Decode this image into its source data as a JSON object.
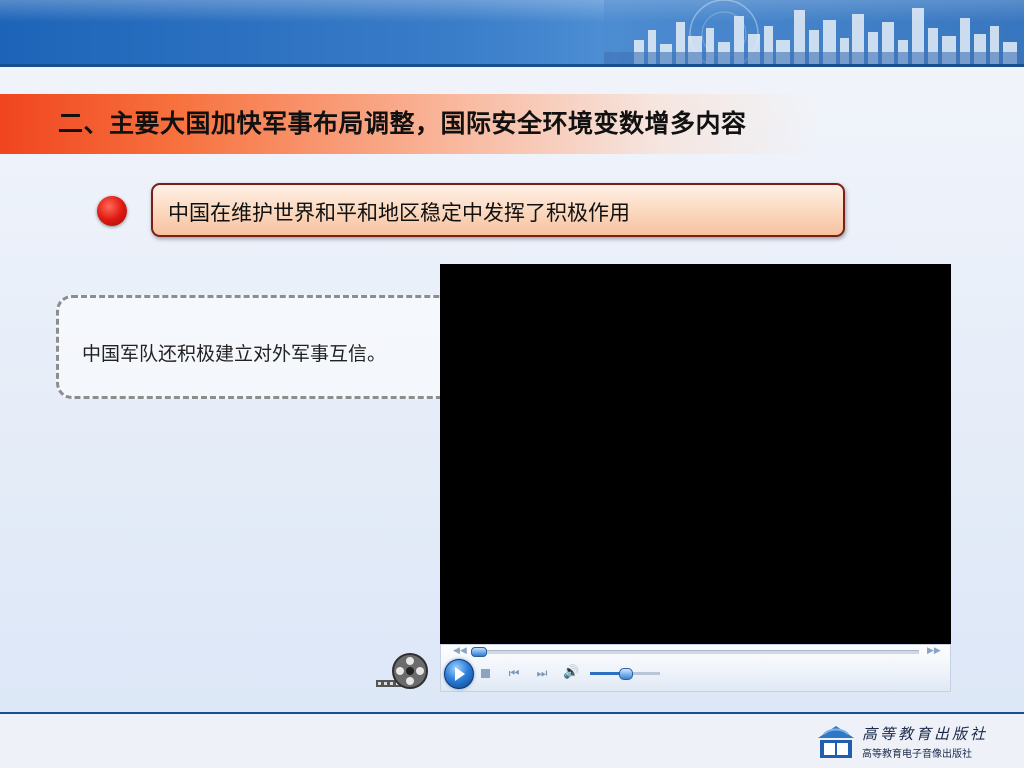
{
  "slide": {
    "section_title": "二、主要大国加快军事布局调整，国际安全环境变数增多内容",
    "key_point": "中国在维护世界和平和地区稳定中发挥了积极作用",
    "detail_text": "中国军队还积极建立对外军事互信。"
  },
  "media_player": {
    "state": "stopped",
    "seek_progress": 0.0,
    "volume_level": 0.5,
    "icons": {
      "rewind": "rewind-icon",
      "fast_forward": "fast-forward-icon",
      "play": "play-icon",
      "stop": "stop-icon",
      "previous": "previous-track-icon",
      "next": "next-track-icon",
      "volume": "volume-icon"
    }
  },
  "footer": {
    "publisher_name": "高等教育出版社",
    "publisher_subtitle": "高等教育电子音像出版社",
    "logo_icon": "publisher-logo-icon"
  },
  "colors": {
    "banner_blue": "#1d64b8",
    "title_accent": "#f0451f",
    "bullet_red": "#e01a12",
    "point_border": "#7a1e16",
    "video_bg": "#000000"
  }
}
